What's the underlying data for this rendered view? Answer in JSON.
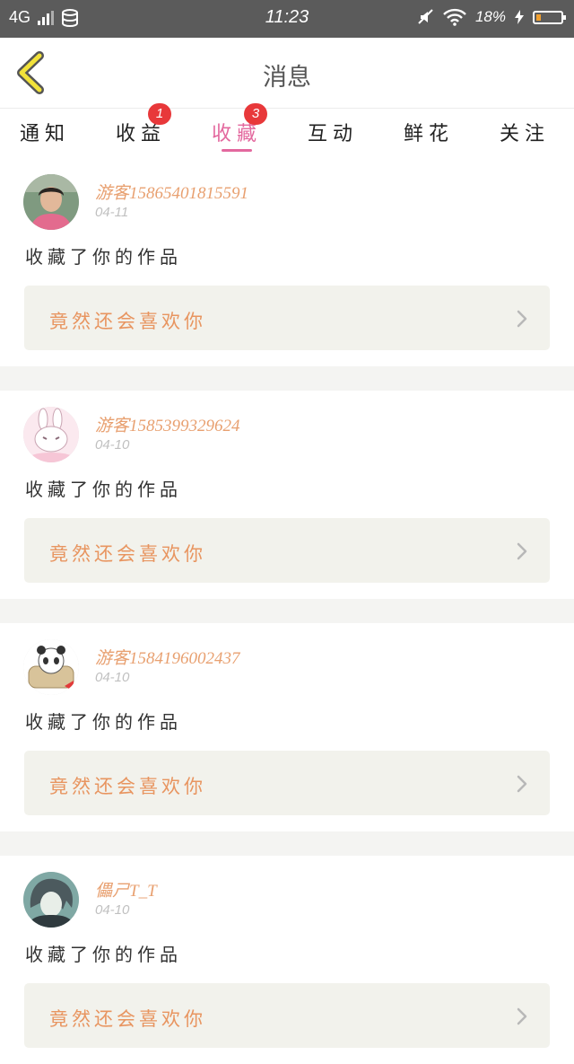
{
  "status_bar": {
    "network": "4G",
    "time": "11:23",
    "battery": "18%",
    "battery_level": 0.18
  },
  "header": {
    "title": "消息"
  },
  "tabs": [
    {
      "label": "通知",
      "badge": "",
      "active": false
    },
    {
      "label": "收益",
      "badge": "1",
      "active": false
    },
    {
      "label": "收藏",
      "badge": "3",
      "active": true
    },
    {
      "label": "互动",
      "badge": "",
      "active": false
    },
    {
      "label": "鲜花",
      "badge": "",
      "active": false
    },
    {
      "label": "关注",
      "badge": "",
      "active": false
    }
  ],
  "messages": [
    {
      "user": "游客15865401815591",
      "date": "04-11",
      "action": "收藏了你的作品",
      "work": "竟然还会喜欢你",
      "avatar": "avatar-woman-photo"
    },
    {
      "user": "游客1585399329624",
      "date": "04-10",
      "action": "收藏了你的作品",
      "work": "竟然还会喜欢你",
      "avatar": "avatar-bunny-cartoon"
    },
    {
      "user": "游客1584196002437",
      "date": "04-10",
      "action": "收藏了你的作品",
      "work": "竟然还会喜欢你",
      "avatar": "avatar-panda-cartoon"
    },
    {
      "user": "儡ㄕT_T",
      "date": "04-10",
      "action": "收藏了你的作品",
      "work": "竟然还会喜欢你",
      "avatar": "avatar-anime-character"
    }
  ],
  "colors": {
    "accent_pink": "#e3689e",
    "name_orange": "#e8a070",
    "work_orange": "#e89560",
    "badge_red": "#e8383a",
    "back_yellow": "#f2e23a"
  }
}
